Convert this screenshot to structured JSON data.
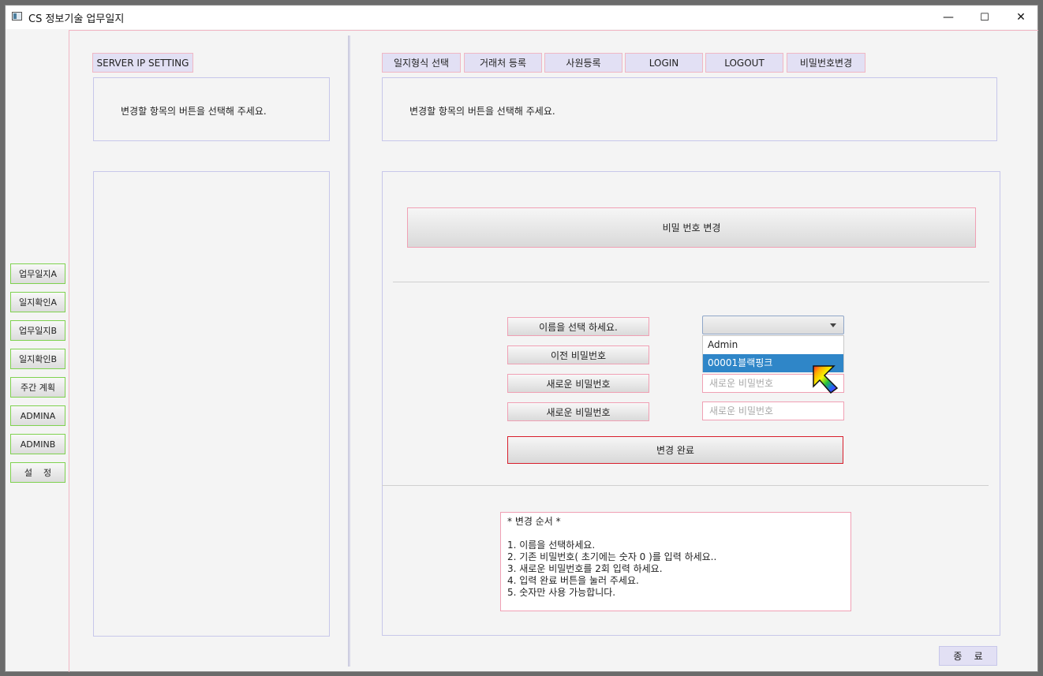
{
  "window": {
    "title": "CS 정보기술 업무일지",
    "minimize": "—",
    "maximize": "☐",
    "close": "✕"
  },
  "sidebar": {
    "items": [
      {
        "label": "업무일지A"
      },
      {
        "label": "일지확인A"
      },
      {
        "label": "업무일지B"
      },
      {
        "label": "일지확인B"
      },
      {
        "label": "주간 계획"
      },
      {
        "label": "ADMINA"
      },
      {
        "label": "ADMINB"
      },
      {
        "label": "설    정"
      }
    ]
  },
  "left_panel": {
    "tab_label": "SERVER IP SETTING",
    "message": "변경할 항목의 버튼을 선택해 주세요."
  },
  "tabs": [
    {
      "label": "일지형식 선택"
    },
    {
      "label": "거래처 등록"
    },
    {
      "label": "사원등록"
    },
    {
      "label": "LOGIN"
    },
    {
      "label": "LOGOUT"
    },
    {
      "label": "비밀번호변경"
    }
  ],
  "right_panel": {
    "message": "변경할 항목의 버튼을 선택해 주세요."
  },
  "password_form": {
    "header": "비밀 번호 변경",
    "name_label": "이름을 선택 하세요.",
    "old_pw_label": "이전 비밀번호",
    "new_pw_label": "새로운 비밀번호",
    "new_pw_confirm_label": "새로운 비밀번호",
    "name_select_value": "",
    "name_options": [
      "Admin",
      "00001블랙핑크"
    ],
    "selected_option_index": 1,
    "new_pw_placeholder": "새로운 비밀번호",
    "new_pw_confirm_placeholder": "새로운 비밀번호",
    "submit_label": "변경 완료"
  },
  "instructions": {
    "title": "* 변경 순서 *",
    "lines": [
      "1. 이름을 선택하세요.",
      "2. 기존 비밀번호( 초기에는 숫자 0 )를 입력 하세요..",
      "3. 새로운 비밀번호를 2회 입력 하세요.",
      "4. 입력 완료 버튼을 눌러 주세요.",
      "5. 숫자만 사용 가능합니다."
    ]
  },
  "footer": {
    "exit_label": "종    료"
  },
  "colors": {
    "tab_bg": "#e2e0f4",
    "pink_border": "#f0a0b4",
    "green_border": "#7fd24f",
    "selected": "#2f86c8",
    "submit_border": "#d81e2c"
  }
}
